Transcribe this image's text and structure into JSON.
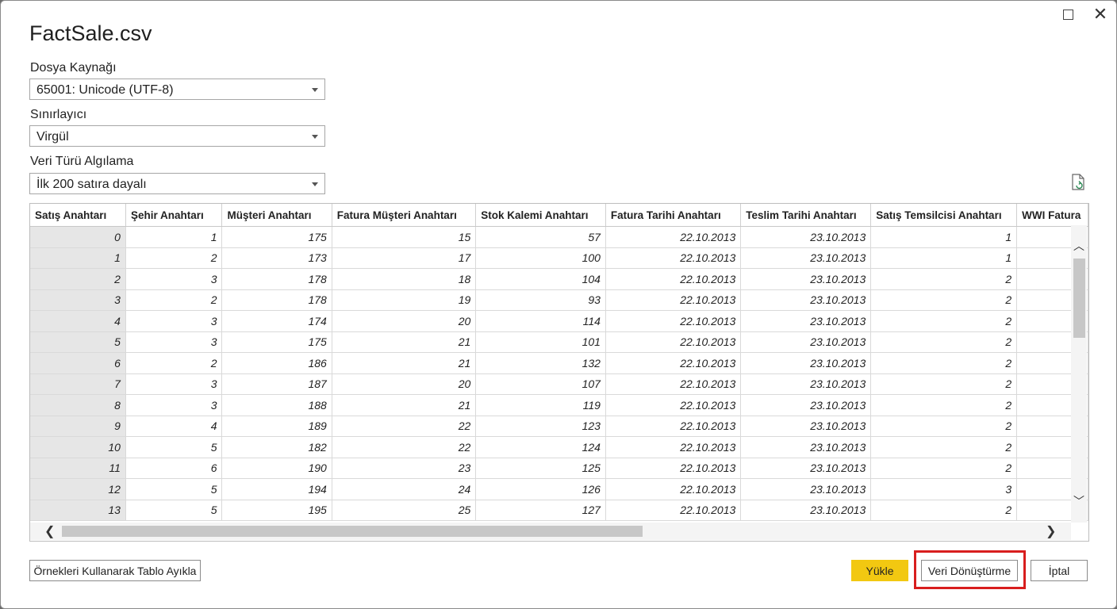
{
  "window": {
    "title": "FactSale.csv",
    "maximize_label": "",
    "close_label": "✕"
  },
  "fields": {
    "file_origin": {
      "label": "Dosya Kaynağı",
      "value": "65001: Unicode (UTF-8)"
    },
    "delimiter": {
      "label": "Sınırlayıcı",
      "value": "Virgül"
    },
    "type_detection": {
      "label": "Veri Türü Algılama",
      "value": "İlk 200 satıra dayalı"
    }
  },
  "table": {
    "columns": [
      "Satış Anahtarı",
      "Şehir Anahtarı",
      "Müşteri Anahtarı",
      "Fatura Müşteri Anahtarı",
      "Stok Kalemi Anahtarı",
      "Fatura Tarihi Anahtarı",
      "Teslim Tarihi Anahtarı",
      "Satış Temsilcisi Anahtarı",
      "WWI Fatura"
    ],
    "rows": [
      [
        "0",
        "1",
        "175",
        "15",
        "57",
        "22.10.2013",
        "23.10.2013",
        "1",
        ""
      ],
      [
        "1",
        "2",
        "173",
        "17",
        "100",
        "22.10.2013",
        "23.10.2013",
        "1",
        ""
      ],
      [
        "2",
        "3",
        "178",
        "18",
        "104",
        "22.10.2013",
        "23.10.2013",
        "2",
        ""
      ],
      [
        "3",
        "2",
        "178",
        "19",
        "93",
        "22.10.2013",
        "23.10.2013",
        "2",
        ""
      ],
      [
        "4",
        "3",
        "174",
        "20",
        "114",
        "22.10.2013",
        "23.10.2013",
        "2",
        ""
      ],
      [
        "5",
        "3",
        "175",
        "21",
        "101",
        "22.10.2013",
        "23.10.2013",
        "2",
        ""
      ],
      [
        "6",
        "2",
        "186",
        "21",
        "132",
        "22.10.2013",
        "23.10.2013",
        "2",
        ""
      ],
      [
        "7",
        "3",
        "187",
        "20",
        "107",
        "22.10.2013",
        "23.10.2013",
        "2",
        ""
      ],
      [
        "8",
        "3",
        "188",
        "21",
        "119",
        "22.10.2013",
        "23.10.2013",
        "2",
        ""
      ],
      [
        "9",
        "4",
        "189",
        "22",
        "123",
        "22.10.2013",
        "23.10.2013",
        "2",
        ""
      ],
      [
        "10",
        "5",
        "182",
        "22",
        "124",
        "22.10.2013",
        "23.10.2013",
        "2",
        ""
      ],
      [
        "11",
        "6",
        "190",
        "23",
        "125",
        "22.10.2013",
        "23.10.2013",
        "2",
        ""
      ],
      [
        "12",
        "5",
        "194",
        "24",
        "126",
        "22.10.2013",
        "23.10.2013",
        "3",
        ""
      ],
      [
        "13",
        "5",
        "195",
        "25",
        "127",
        "22.10.2013",
        "23.10.2013",
        "2",
        ""
      ]
    ]
  },
  "buttons": {
    "extract": "Örnekleri Kullanarak Tablo Ayıkla",
    "load": "Yükle",
    "transform": "Veri Dönüştürme",
    "cancel": "İptal"
  },
  "icons": {
    "refresh": "refresh-document-icon"
  },
  "colors": {
    "load_button": "#f2c811",
    "highlight_border": "#d81e1e"
  }
}
